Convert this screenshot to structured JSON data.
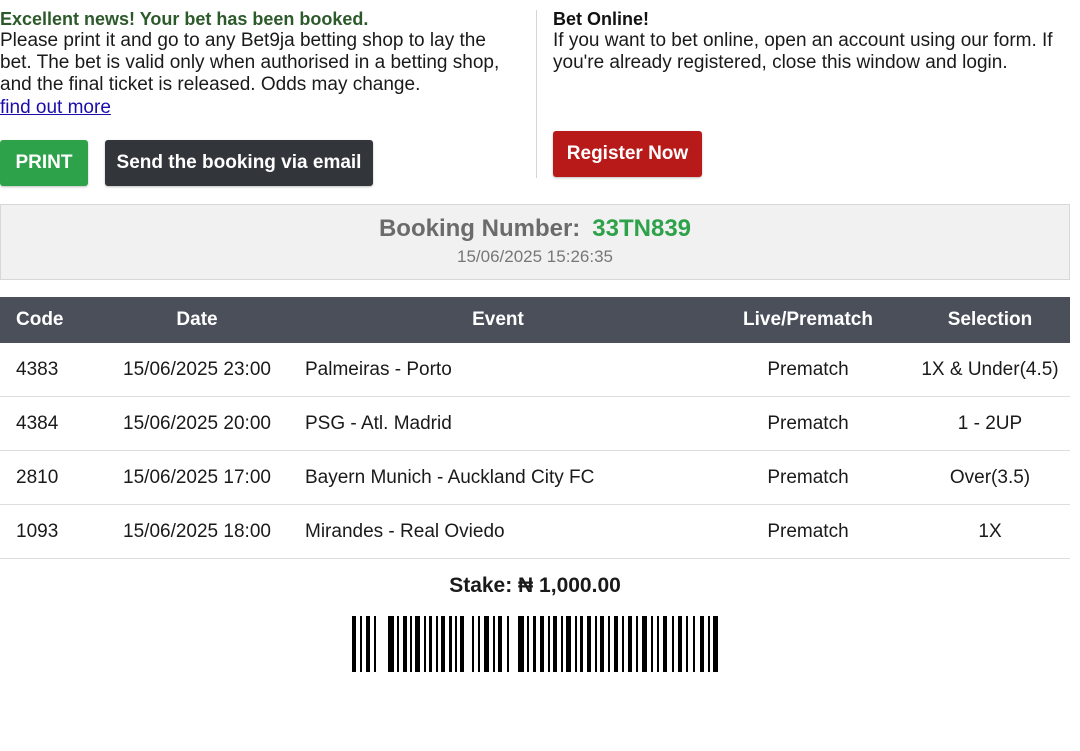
{
  "left": {
    "headline": "Excellent news! Your bet has been booked.",
    "message_lines": [
      "Please print it and go to any Bet9ja betting shop to lay the",
      "bet. The bet is valid only when authorised in a betting shop,",
      "and the final ticket is released. Odds may change."
    ],
    "link": "find out more",
    "print_label": "PRINT",
    "email_label": "Send the booking via email"
  },
  "right": {
    "headline": "Bet Online!",
    "message_lines": [
      "If you want to bet online, open an account using our form. If",
      "you're already registered, close this window and login."
    ],
    "register_label": "Register Now"
  },
  "booking": {
    "label": "Booking Number:",
    "number": "33TN839",
    "datetime": "15/06/2025 15:26:35"
  },
  "table": {
    "headers": [
      "Code",
      "Date",
      "Event",
      "Live/Prematch",
      "Selection"
    ],
    "rows": [
      {
        "code": "4383",
        "date": "15/06/2025 23:00",
        "event": "Palmeiras - Porto",
        "mode": "Prematch",
        "selection": "1X & Under(4.5)"
      },
      {
        "code": "4384",
        "date": "15/06/2025 20:00",
        "event": "PSG - Atl. Madrid",
        "mode": "Prematch",
        "selection": "1 - 2UP"
      },
      {
        "code": "2810",
        "date": "15/06/2025 17:00",
        "event": "Bayern Munich - Auckland City FC",
        "mode": "Prematch",
        "selection": "Over(3.5)"
      },
      {
        "code": "1093",
        "date": "15/06/2025 18:00",
        "event": "Mirandes - Real Oviedo",
        "mode": "Prematch",
        "selection": "1X"
      }
    ]
  },
  "stake": "Stake: ₦ 1,000.00",
  "colors": {
    "green": "#2ea24a",
    "dark": "#323539",
    "red": "#b81a1a",
    "table_header": "#4a4f5a",
    "headline_green": "#2d5a2b"
  },
  "icons": {
    "barcode": "barcode-icon"
  }
}
